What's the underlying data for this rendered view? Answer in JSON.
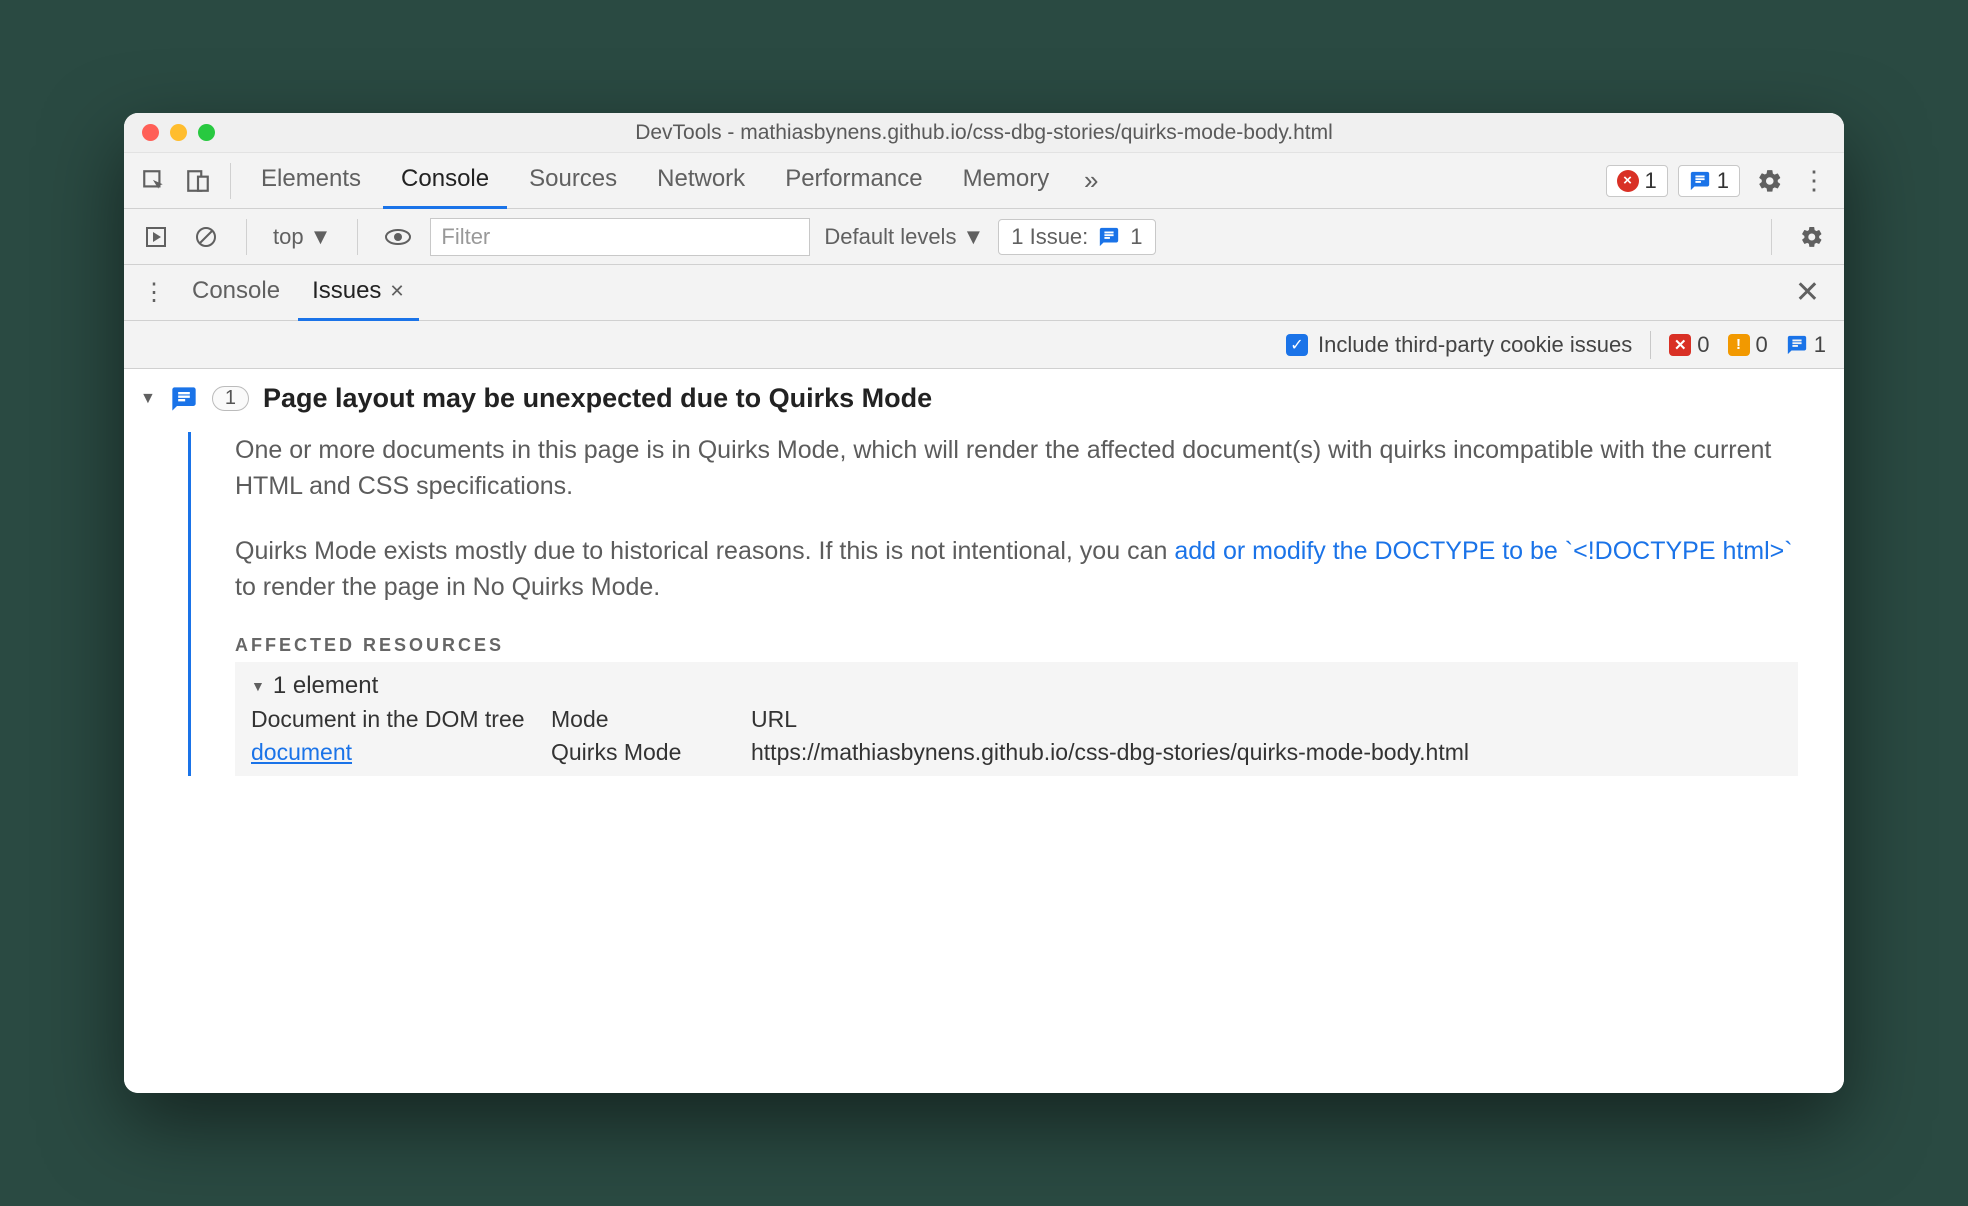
{
  "window_title": "DevTools - mathiasbynens.github.io/css-dbg-stories/quirks-mode-body.html",
  "main_tabs": {
    "elements": "Elements",
    "console": "Console",
    "sources": "Sources",
    "network": "Network",
    "performance": "Performance",
    "memory": "Memory"
  },
  "top_right": {
    "error_count": "1",
    "issue_count": "1"
  },
  "filterbar": {
    "context": "top",
    "filter_placeholder": "Filter",
    "levels": "Default levels",
    "issue_label": "1 Issue:",
    "issue_count": "1"
  },
  "drawer_tabs": {
    "console": "Console",
    "issues": "Issues"
  },
  "issues_toolbar": {
    "checkbox_label": "Include third-party cookie issues",
    "errors": "0",
    "warnings": "0",
    "info": "1"
  },
  "issue": {
    "count": "1",
    "title": "Page layout may be unexpected due to Quirks Mode",
    "para1": "One or more documents in this page is in Quirks Mode, which will render the affected document(s) with quirks incompatible with the current HTML and CSS specifications.",
    "para2_a": "Quirks Mode exists mostly due to historical reasons. If this is not intentional, you can ",
    "para2_link": "add or modify the DOCTYPE to be `<!DOCTYPE html>`",
    "para2_b": " to render the page in No Quirks Mode.",
    "affected_heading": "AFFECTED RESOURCES",
    "element_count": "1 element",
    "table": {
      "h1": "Document in the DOM tree",
      "h2": "Mode",
      "h3": "URL",
      "c1": "document",
      "c2": "Quirks Mode",
      "c3": "https://mathiasbynens.github.io/css-dbg-stories/quirks-mode-body.html"
    }
  }
}
